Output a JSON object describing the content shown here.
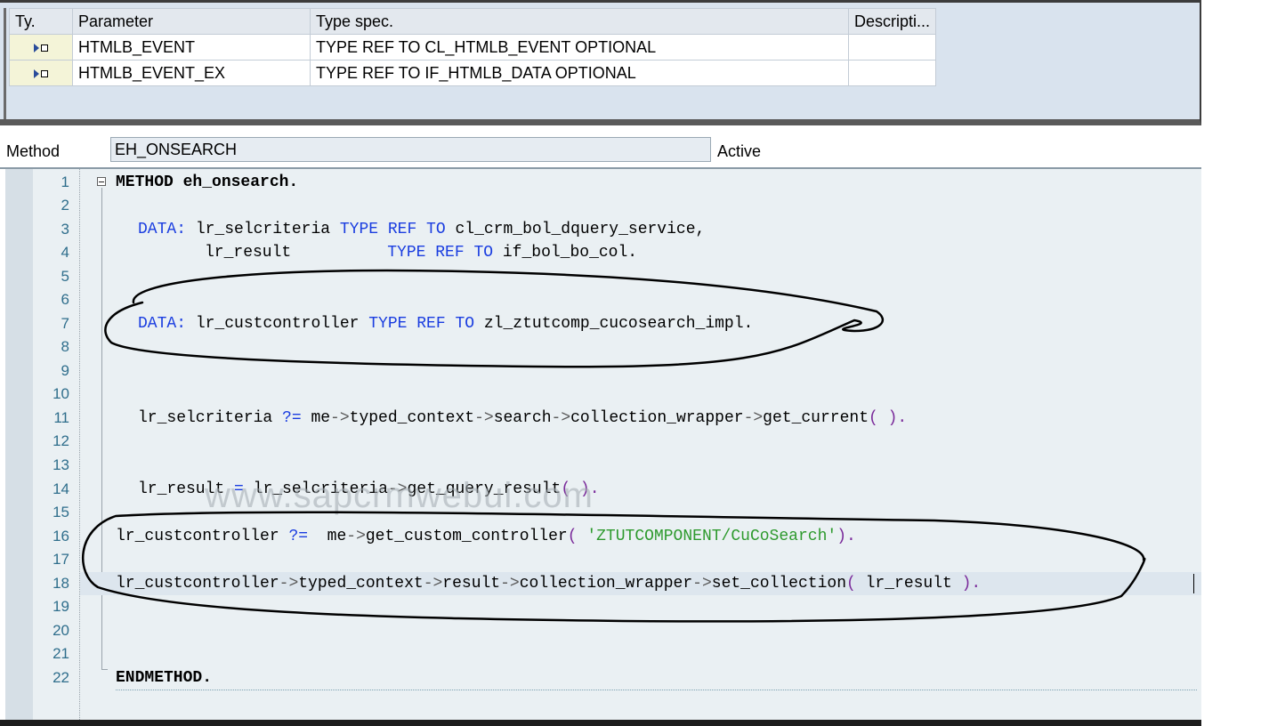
{
  "params": {
    "headers": [
      "Ty.",
      "Parameter",
      "Type spec.",
      "Descripti..."
    ],
    "rows": [
      {
        "parameter": "HTMLB_EVENT",
        "type_spec": "TYPE REF TO CL_HTMLB_EVENT OPTIONAL",
        "description": ""
      },
      {
        "parameter": "HTMLB_EVENT_EX",
        "type_spec": "TYPE REF TO IF_HTMLB_DATA OPTIONAL",
        "description": ""
      }
    ],
    "ty_icon": "importing-parameter-icon"
  },
  "method": {
    "label": "Method",
    "name": "EH_ONSEARCH",
    "status": "Active"
  },
  "editor": {
    "line_numbers": [
      "1",
      "2",
      "3",
      "4",
      "5",
      "6",
      "7",
      "8",
      "9",
      "10",
      "11",
      "12",
      "13",
      "14",
      "15",
      "16",
      "17",
      "18",
      "19",
      "20",
      "21",
      "22"
    ],
    "l1": {
      "kw": "METHOD",
      "rest": " eh_onsearch."
    },
    "l3": {
      "kw1": "DATA:",
      "mid": " lr_selcriteria ",
      "kw2": "TYPE REF TO",
      "rest": " cl_crm_bol_dquery_service,"
    },
    "l4": {
      "mid": "lr_result          ",
      "kw2": "TYPE REF TO",
      "rest": " if_bol_bo_col."
    },
    "l7": {
      "kw1": "DATA:",
      "mid": " lr_custcontroller ",
      "kw2": "TYPE REF TO",
      "rest": " zl_ztutcomp_cucosearch_impl."
    },
    "l11": {
      "a": "lr_selcriteria ",
      "op1": "?=",
      "b": " me",
      "op2": "->",
      "c": "typed_context",
      "op3": "->",
      "d": "search",
      "op4": "->",
      "e": "collection_wrapper",
      "op5": "->",
      "f": "get_current",
      "op6": "( ).",
      "g": ""
    },
    "l14": {
      "a": "lr_result ",
      "op1": "=",
      "b": " lr_selcriteria",
      "op2": "->",
      "c": "get_query_result",
      "op3": "( )."
    },
    "l16": {
      "a": "lr_custcontroller ",
      "op1": "?=",
      "b": "  me",
      "op2": "->",
      "c": "get_custom_controller",
      "op3": "( ",
      "str": "'ZTUTCOMPONENT/CuCoSearch'",
      "op4": ")."
    },
    "l18": {
      "a": "lr_custcontroller",
      "op1": "->",
      "b": "typed_context",
      "op2": "->",
      "c": "result",
      "op3": "->",
      "d": "collection_wrapper",
      "op4": "->",
      "e": "set_collection",
      "op5": "( ",
      "f": "lr_result",
      "op6": " )."
    },
    "l22": {
      "kw": "ENDMETHOD."
    }
  },
  "watermark": "www.sapcrmwebui.com",
  "colors": {
    "keyword": "#1a3de0",
    "string": "#2e9a2e",
    "operator": "#5a5a5a",
    "line_number": "#2f6e8c",
    "editor_bg": "#eaf0f3",
    "panel_bg": "#d9e3ee"
  }
}
